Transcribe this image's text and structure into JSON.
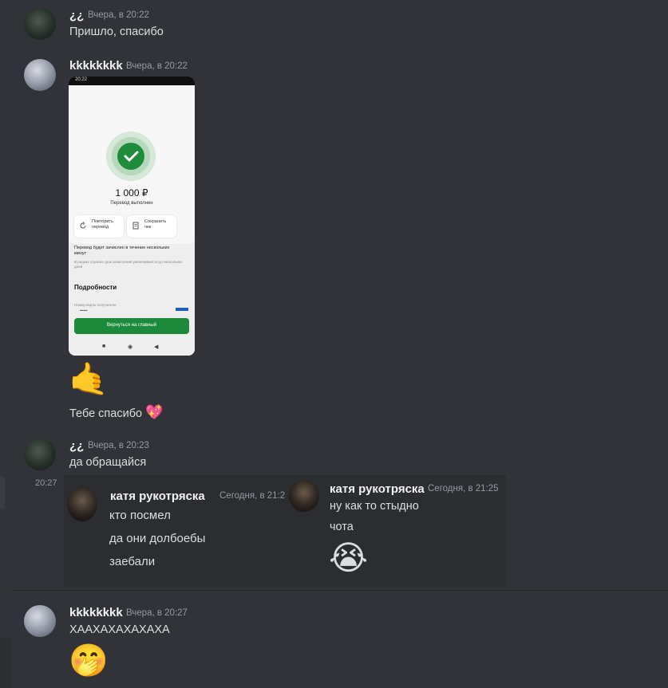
{
  "messages": {
    "m1": {
      "user": "¿¿",
      "time": "Вчера, в 20:22",
      "text": "Пришло, спасибо"
    },
    "m2": {
      "user": "kkkkkkkk",
      "time": "Вчера, в 20:22",
      "screenshot": {
        "status_time": "20:22",
        "amount": "1 000 ₽",
        "status": "Перевод выполнен",
        "repeat_label": "Повторить перевод",
        "save_label": "Сохранить чек",
        "info_title": "Перевод будет зачислен в течение нескольких минут",
        "info_sub": "В редких случаях срок зачисления увеличивается до нескольких дней",
        "details_title": "Подробности",
        "card_label": "Номер карты получателя",
        "card_value": "••••••",
        "main_button": "Вернуться на главный"
      },
      "emoji": "🤙",
      "text": "Тебе спасибо",
      "text_emoji": "💖"
    },
    "m3": {
      "user": "¿¿",
      "time": "Вчера, в 20:23",
      "text": "да обращайся"
    },
    "embed": {
      "side_time": "20:27",
      "left": {
        "user": "катя рукотряска",
        "time": "Сегодня, в 21:2",
        "lines": [
          "кто посмел",
          "да они долбоебы",
          "заебали"
        ]
      },
      "right": {
        "user": "катя рукотряска",
        "time": "Сегодня, в 21:25",
        "lines": [
          "ну как то стыдно",
          "чота"
        ],
        "emoji": "😭"
      }
    },
    "m4": {
      "user": "kkkkkkkk",
      "time": "Вчера, в 20:27",
      "text": "ХААХАХАХАХАХА",
      "emoji": "🤭"
    }
  }
}
